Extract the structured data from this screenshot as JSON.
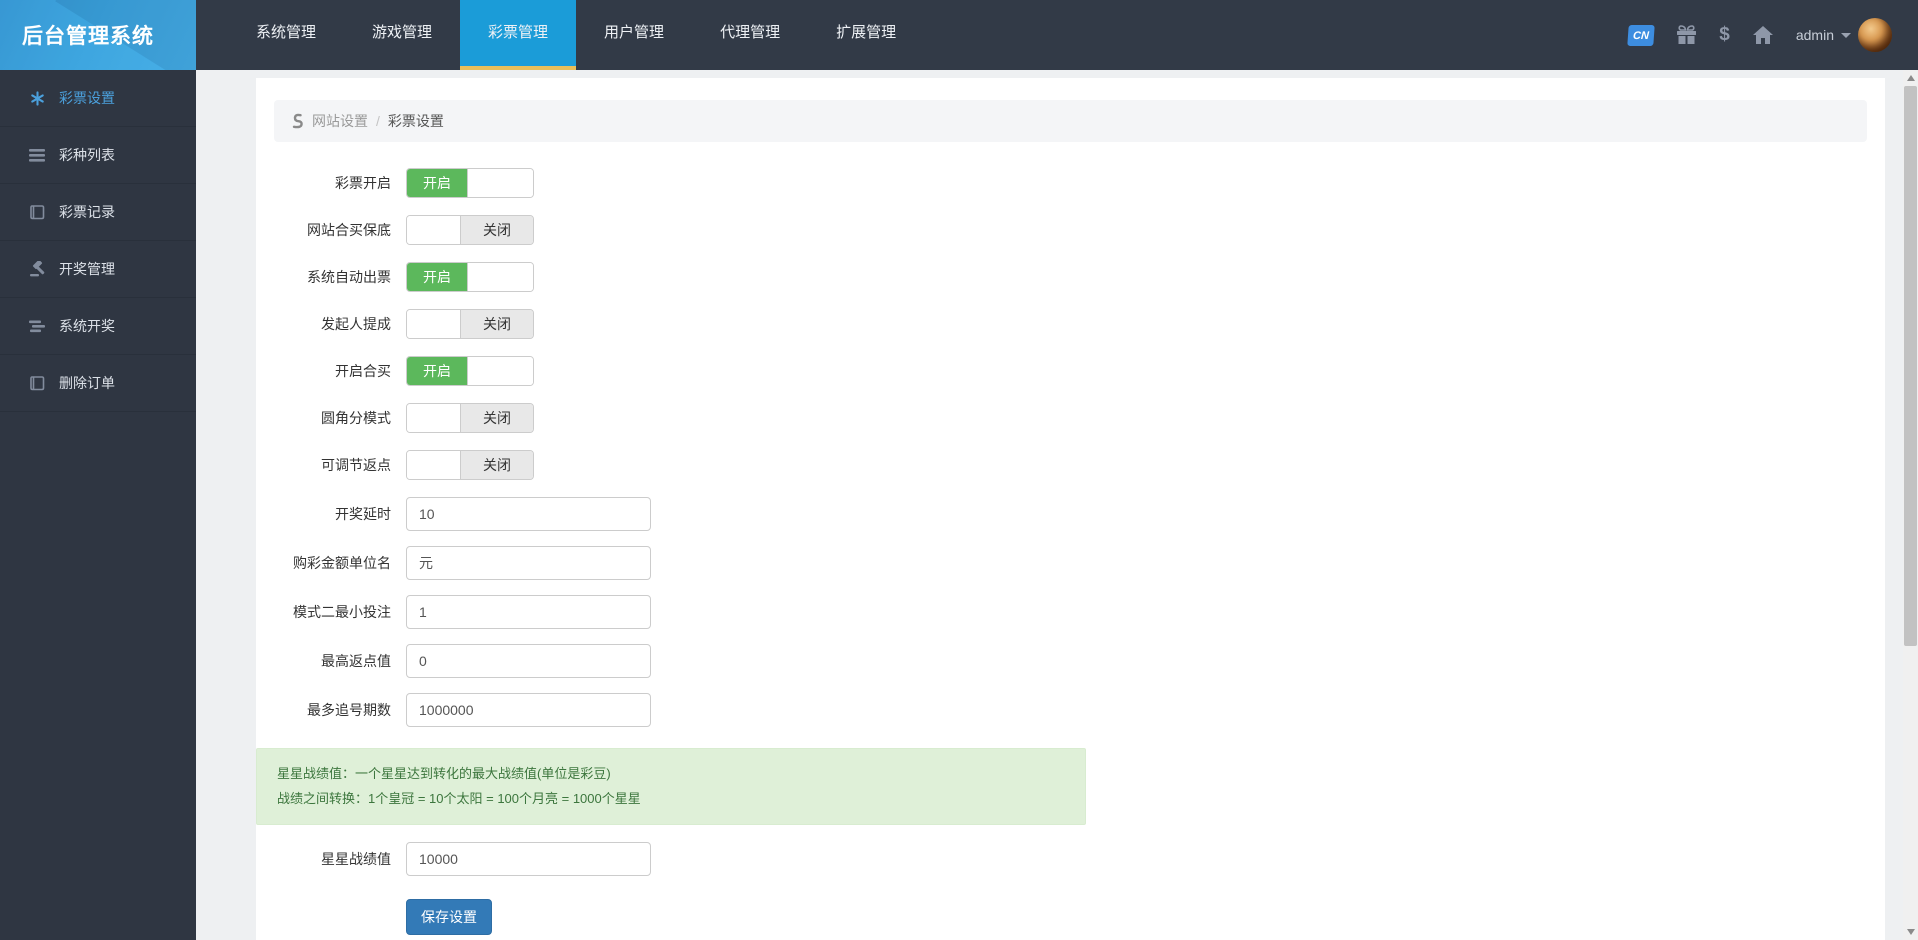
{
  "app": {
    "title": "后台管理系统"
  },
  "topnav": {
    "tabs": [
      {
        "label": "系统管理",
        "active": false
      },
      {
        "label": "游戏管理",
        "active": false
      },
      {
        "label": "彩票管理",
        "active": true
      },
      {
        "label": "用户管理",
        "active": false
      },
      {
        "label": "代理管理",
        "active": false
      },
      {
        "label": "扩展管理",
        "active": false
      }
    ],
    "badge_text": "CN",
    "dollar_text": "$",
    "user": {
      "name": "admin"
    }
  },
  "sidebar": {
    "items": [
      {
        "label": "彩票设置",
        "icon": "asterisk-icon",
        "active": true
      },
      {
        "label": "彩种列表",
        "icon": "list-icon",
        "active": false
      },
      {
        "label": "彩票记录",
        "icon": "book-icon",
        "active": false
      },
      {
        "label": "开奖管理",
        "icon": "gavel-icon",
        "active": false
      },
      {
        "label": "系统开奖",
        "icon": "bars-icon",
        "active": false
      },
      {
        "label": "删除订单",
        "icon": "book-icon",
        "active": false
      }
    ]
  },
  "breadcrumb": {
    "parent": "网站设置",
    "separator": "/",
    "current": "彩票设置"
  },
  "form": {
    "toggles": [
      {
        "label": "彩票开启",
        "state": "on",
        "text": "开启"
      },
      {
        "label": "网站合买保底",
        "state": "off",
        "text": "关闭"
      },
      {
        "label": "系统自动出票",
        "state": "on",
        "text": "开启"
      },
      {
        "label": "发起人提成",
        "state": "off",
        "text": "关闭"
      },
      {
        "label": "开启合买",
        "state": "on",
        "text": "开启"
      },
      {
        "label": "圆角分模式",
        "state": "off",
        "text": "关闭"
      },
      {
        "label": "可调节返点",
        "state": "off",
        "text": "关闭"
      }
    ],
    "inputs": [
      {
        "label": "开奖延时",
        "value": "10"
      },
      {
        "label": "购彩金额单位名",
        "value": "元"
      },
      {
        "label": "模式二最小投注",
        "value": "1"
      },
      {
        "label": "最高返点值",
        "value": "0"
      },
      {
        "label": "最多追号期数",
        "value": "1000000"
      }
    ],
    "notice": {
      "line1": "星星战绩值：一个星星达到转化的最大战绩值(单位是彩豆)",
      "line2": "战绩之间转换：1个皇冠 = 10个太阳 = 100个月亮 = 1000个星星"
    },
    "star_field": {
      "label": "星星战绩值",
      "value": "10000"
    },
    "save_label": "保存设置"
  },
  "colors": {
    "navbar_bg": "#323a47",
    "sidebar_bg": "#2f3642",
    "logo_blue": "#1e97da",
    "active_tab_blue": "#1b9cd8",
    "active_tab_underline": "#e9bf5a",
    "sidebar_active_text": "#4ba0dc",
    "toggle_on_green": "#5cb85c",
    "alert_bg": "#dff0d8",
    "alert_text": "#3c763d",
    "save_button_blue": "#337ab7"
  }
}
